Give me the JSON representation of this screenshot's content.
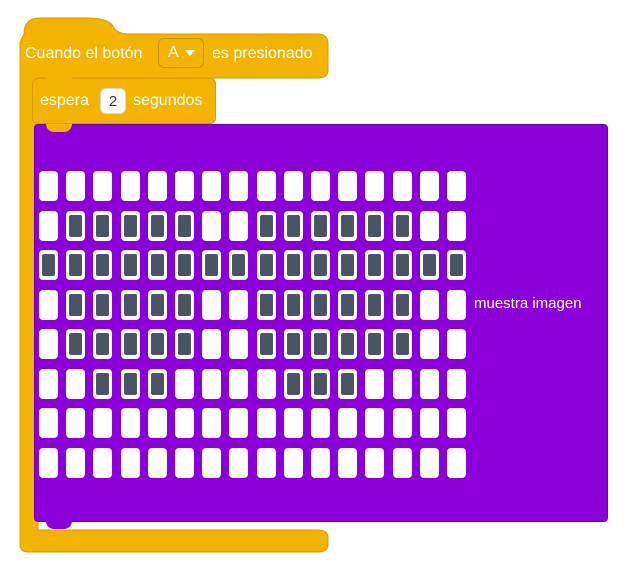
{
  "event_block": {
    "prefix": "Cuando el botón",
    "button_value": "A",
    "suffix": "es presionado",
    "color": "#f2b400"
  },
  "wait_block": {
    "label_before": "espera",
    "seconds": "2",
    "label_after": "segundos"
  },
  "show_image_block": {
    "label": "muestra imagen",
    "color": "#8b00d9",
    "led_on_color": "#4a5564",
    "led_off_color": "#ffffff",
    "rows": [
      "0000000000000000",
      "0111110011111100",
      "1111111111111111",
      "0111110011111100",
      "0111110011111100",
      "0011100001110000",
      "0000000000000000",
      "0000000000000000"
    ]
  }
}
